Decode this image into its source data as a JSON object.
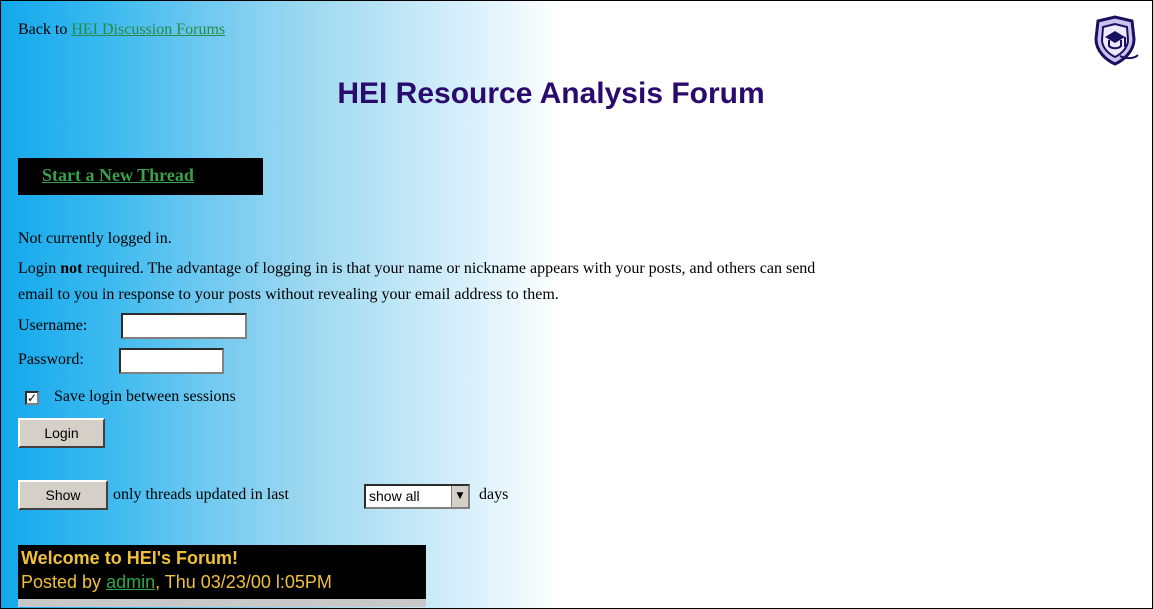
{
  "header": {
    "back_prefix": "Back to ",
    "back_link": "HEI Discussion Forums",
    "title": "HEI Resource Analysis Forum",
    "logo_icon": "hei-shield-logo-icon"
  },
  "new_thread_button": "Start a New Thread",
  "login": {
    "status": "Not currently logged in.",
    "info_part1": "Login ",
    "info_bold": "not",
    "info_part2": " required. The advantage of logging in is that your name or nickname appears with your posts, and others can send",
    "info_line2": "email to you in response to your posts without revealing your email address to them.",
    "username_label": "Username:",
    "username_value": "",
    "password_label": "Password:",
    "password_value": "",
    "save_label": "Save login between sessions",
    "save_checked": true,
    "login_button": "Login"
  },
  "filter": {
    "show_button": "Show",
    "text": "only threads updated in last",
    "selected": "show all",
    "suffix": "days"
  },
  "post": {
    "title": "Welcome to HEI's Forum!",
    "posted_by": "Posted by ",
    "author": "admin",
    "date": ", Thu 03/23/00 l:05PM"
  },
  "colors": {
    "title": "#2b0a6e",
    "link": "#2a8a40",
    "post_text": "#f0c038"
  }
}
